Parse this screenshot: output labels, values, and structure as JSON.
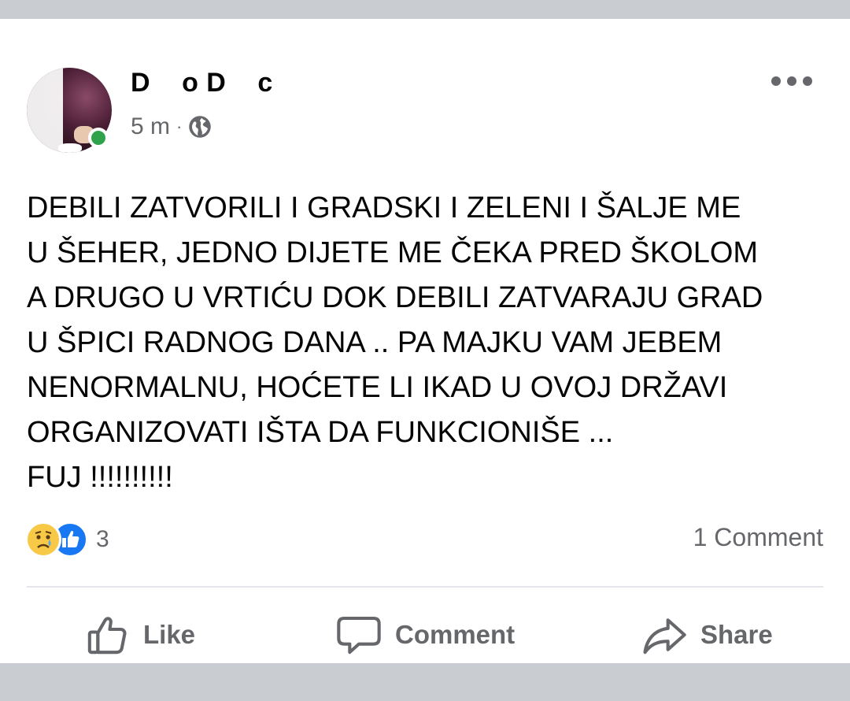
{
  "post": {
    "author_start": "D",
    "author_mid": "o D",
    "author_end": "c",
    "time": "5 m",
    "separator": "·",
    "privacy_icon": "globe-icon",
    "text": "DEBILI ZATVORILI I GRADSKI I ZELENI I ŠALJE ME\nU ŠEHER, JEDNO DIJETE ME ČEKA PRED ŠKOLOM\nA DRUGO U VRTIĆU DOK DEBILI ZATVARAJU GRAD\nU ŠPICI RADNOG DANA .. PA MAJKU VAM JEBEM\nNENORMALNU, HOĆETE LI IKAD U OVOJ DRŽAVI\nORGANIZOVATI IŠTA DA FUNKCIONIŠE ...\nFUJ !!!!!!!!!!"
  },
  "reactions": {
    "icons": [
      "sad-reaction-icon",
      "like-reaction-icon"
    ],
    "count": "3"
  },
  "comments": {
    "label": "1 Comment"
  },
  "actions": {
    "like": "Like",
    "comment": "Comment",
    "share": "Share"
  },
  "colors": {
    "background": "#c9ccd1",
    "secondary_text": "#65676b",
    "online": "#31a24c",
    "like_blue": "#1877f2",
    "sad_yellow": "#f7c947"
  }
}
